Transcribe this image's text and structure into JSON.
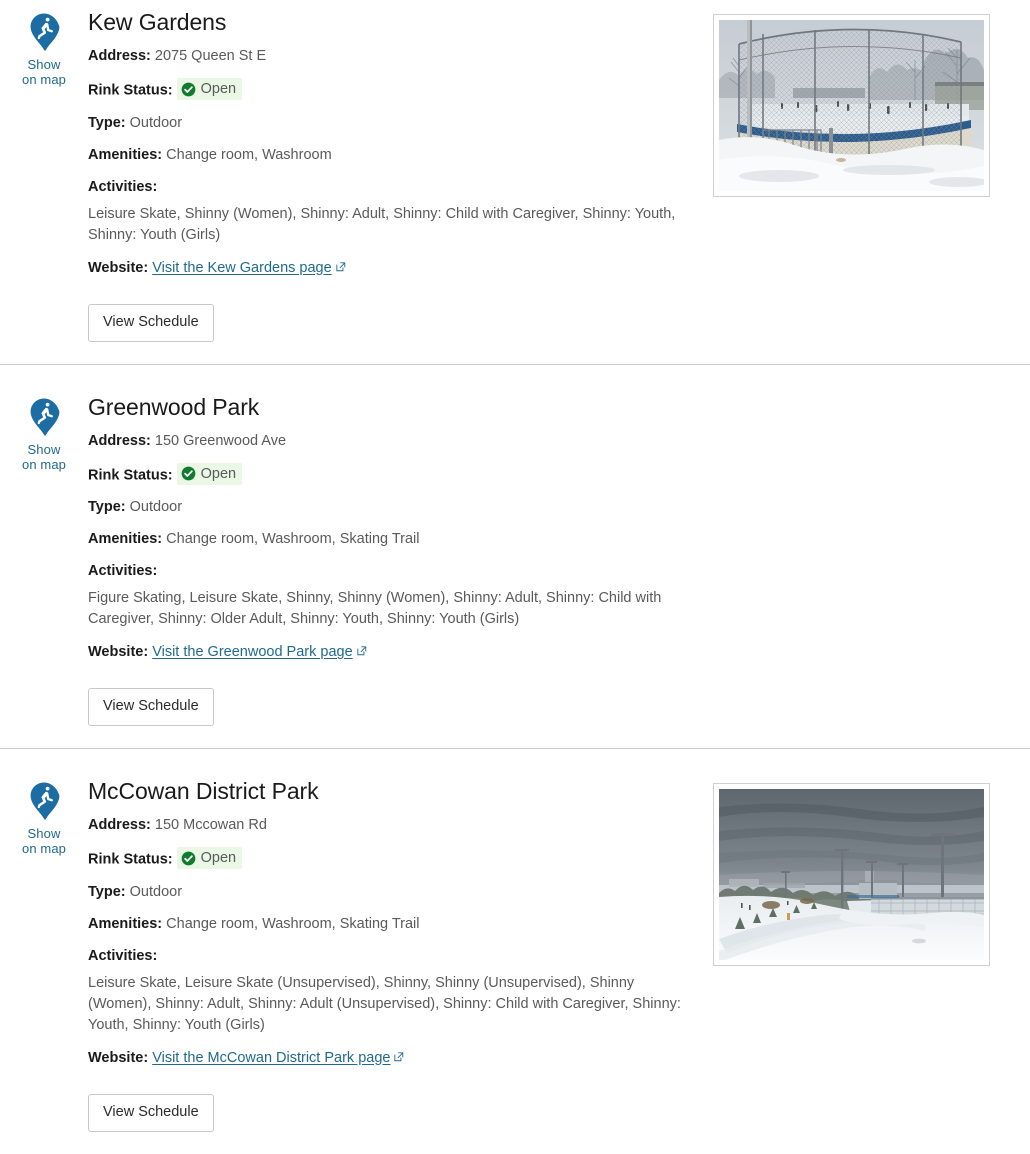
{
  "labels": {
    "address": "Address:",
    "rink_status": "Rink Status:",
    "type": "Type:",
    "amenities": "Amenities:",
    "activities": "Activities:",
    "website": "Website:",
    "show_on_map_line1": "Show",
    "show_on_map_line2": "on map",
    "view_schedule": "View Schedule"
  },
  "colors": {
    "link": "#1f6a8b",
    "pin": "#1b6da3",
    "status_ok": "#0f7b2e",
    "status_bg": "#eaf7e4",
    "label_text": "#1a1a1a",
    "value_text": "#5a5a5a",
    "divider": "#cfcfcf",
    "button_border": "#c8c8c8"
  },
  "icons": {
    "map_pin": "map-pin-skater-icon",
    "status": "check-circle-icon",
    "external_link": "external-link-icon"
  },
  "rinks": [
    {
      "name": "Kew Gardens",
      "address": "2075 Queen St E",
      "status": "Open",
      "type": "Outdoor",
      "amenities": "Change room, Washroom",
      "activities": "Leisure Skate, Shinny (Women), Shinny: Adult, Shinny: Child with Caregiver, Shinny: Youth, Shinny: Youth (Girls)",
      "website_text": "Visit the Kew Gardens page",
      "has_photo": true,
      "photo_alt": "Outdoor ice rink enclosed by a tall chain-link fence with skaters on the ice and snow around the boards"
    },
    {
      "name": "Greenwood Park",
      "address": "150 Greenwood Ave",
      "status": "Open",
      "type": "Outdoor",
      "amenities": "Change room, Washroom, Skating Trail",
      "activities": "Figure Skating, Leisure Skate, Shinny, Shinny (Women), Shinny: Adult, Shinny: Child with Caregiver, Shinny: Older Adult, Shinny: Youth, Shinny: Youth (Girls)",
      "website_text": "Visit the Greenwood Park page",
      "has_photo": false,
      "photo_alt": ""
    },
    {
      "name": "McCowan District Park",
      "address": "150 Mccowan Rd",
      "status": "Open",
      "type": "Outdoor",
      "amenities": "Change room, Washroom, Skating Trail",
      "activities": "Leisure Skate, Leisure Skate (Unsupervised), Shinny, Shinny (Unsupervised), Shinny (Women), Shinny: Adult, Shinny: Adult (Unsupervised), Shinny: Child with Caregiver, Shinny: Youth, Shinny: Youth (Girls)",
      "website_text": "Visit the McCowan District Park page",
      "has_photo": true,
      "photo_alt": "Snow covered park landscape at dusk with light standards and an outdoor rink with clear boards in the distance"
    }
  ]
}
